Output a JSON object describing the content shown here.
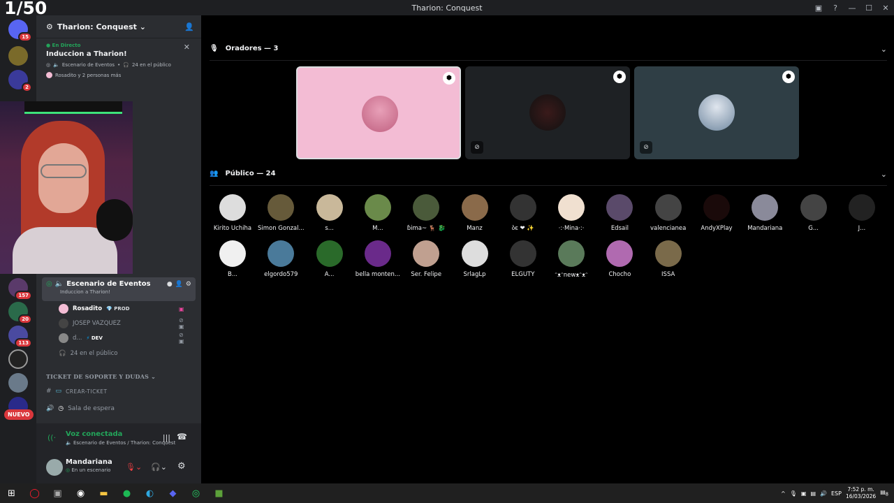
{
  "counter": "1/50",
  "window": {
    "title": "Tharion: Conquest"
  },
  "servers": {
    "badges": [
      "15",
      "2",
      "157",
      "20",
      "113"
    ],
    "new_label": "NUEVO"
  },
  "guild": {
    "name": "Tharion: Conquest"
  },
  "live": {
    "tag": "En Directo",
    "title": "Induccion a Tharion!",
    "line1": "Escenario de Eventos",
    "audience": "24 en el público",
    "line2": "Rosadito y 2 personas más"
  },
  "stage_channel": {
    "name": "Escenario de Eventos",
    "topic": "Induccion a Tharion!",
    "members": [
      {
        "name": "Rosadito",
        "tag": "PROD",
        "color": "#ffffff"
      },
      {
        "name": "JOSEP VAZQUEZ",
        "tag": "",
        "color": "#949ba4"
      },
      {
        "name": "d...",
        "tag": "DEV",
        "color": "#949ba4"
      }
    ],
    "audience": "24 en el público"
  },
  "category": {
    "name": "TICKET DE SOPORTE Y DUDAS"
  },
  "channels": [
    {
      "name": "CREAR-TICKET"
    },
    {
      "name": "Sala de espera"
    }
  ],
  "voice": {
    "status": "Voz conectada",
    "location": "Escenario de Eventos / Tharion: Conquest"
  },
  "user": {
    "name": "Mandariana",
    "status": "En un escenario"
  },
  "speakers": {
    "header": "Oradores — 3"
  },
  "audience_section": {
    "header": "Público — 24",
    "row1": [
      "Kirito Uchiha",
      "Simon Gonzal...",
      "s...",
      "M...",
      "ɓima~ 🦌 🐉",
      "Manz",
      "ბє ❤ ✨",
      "·:·Mina·:·",
      "Edsail",
      "valencianea",
      "AndyXPlay",
      "Mandariana",
      "G...",
      "J..."
    ],
    "row2": [
      "B...",
      "elgordo579",
      "A...",
      "bella monten...",
      "Ser. Felipe",
      "SrlagLp",
      "ELGUTY",
      "ᵔᴥᵔnewᴥᵔᴥᵔ",
      "Chocho",
      "ISSA"
    ]
  },
  "taskbar": {
    "lang": "ESP",
    "time": "7:52 p. m.",
    "date": "16/03/2026",
    "notif": "8"
  },
  "colors": {
    "accent_green": "#23a55a",
    "stage_pink": "#f3bcd4",
    "tile_dark": "#1e2124",
    "tile_teal": "#2f3e45"
  }
}
